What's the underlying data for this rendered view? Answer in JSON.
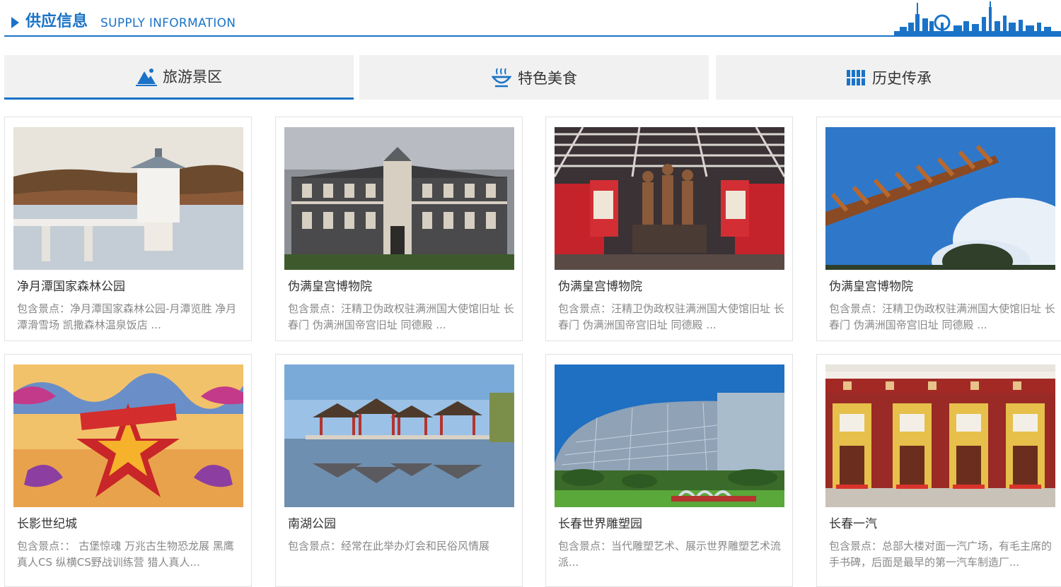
{
  "header": {
    "title": "供应信息",
    "subtitle": "SUPPLY INFORMATION"
  },
  "tabs": [
    {
      "label": "旅游景区",
      "icon": "mountain-icon",
      "active": true
    },
    {
      "label": "特色美食",
      "icon": "food-icon",
      "active": false
    },
    {
      "label": "历史传承",
      "icon": "history-icon",
      "active": false
    }
  ],
  "cards": [
    {
      "name": "净月潭国家森林公园",
      "desc": "包含景点：净月潭国家森林公园-月潭览胜 净月潭滑雪场 凯撒森林温泉饭店 ..."
    },
    {
      "name": "伪满皇宫博物院",
      "desc": "包含景点：汪精卫伪政权驻满洲国大使馆旧址 长春门 伪满洲国帝宫旧址 同德殿 ..."
    },
    {
      "name": "伪满皇宫博物院",
      "desc": "包含景点：汪精卫伪政权驻满洲国大使馆旧址 长春门 伪满洲国帝宫旧址 同德殿 ..."
    },
    {
      "name": "伪满皇宫博物院",
      "desc": "包含景点：汪精卫伪政权驻满洲国大使馆旧址 长春门 伪满洲国帝宫旧址 同德殿 ..."
    },
    {
      "name": "长影世纪城",
      "desc": "包含景点：： 古堡惊魂 万兆古生物恐龙展 黑鹰真人CS 纵横CS野战训练营 猎人真人..."
    },
    {
      "name": "南湖公园",
      "desc": "包含景点：经常在此举办灯会和民俗风情展"
    },
    {
      "name": "长春世界雕塑园",
      "desc": "包含景点：当代雕塑艺术、展示世界雕塑艺术流派..."
    },
    {
      "name": "长春一汽",
      "desc": "包含景点：总部大楼对面一汽广场，有毛主席的手书碑，后面是最早的第一汽车制造厂..."
    }
  ],
  "colors": {
    "accent": "#1a73c7",
    "tab_bg": "#f1f1f1"
  }
}
